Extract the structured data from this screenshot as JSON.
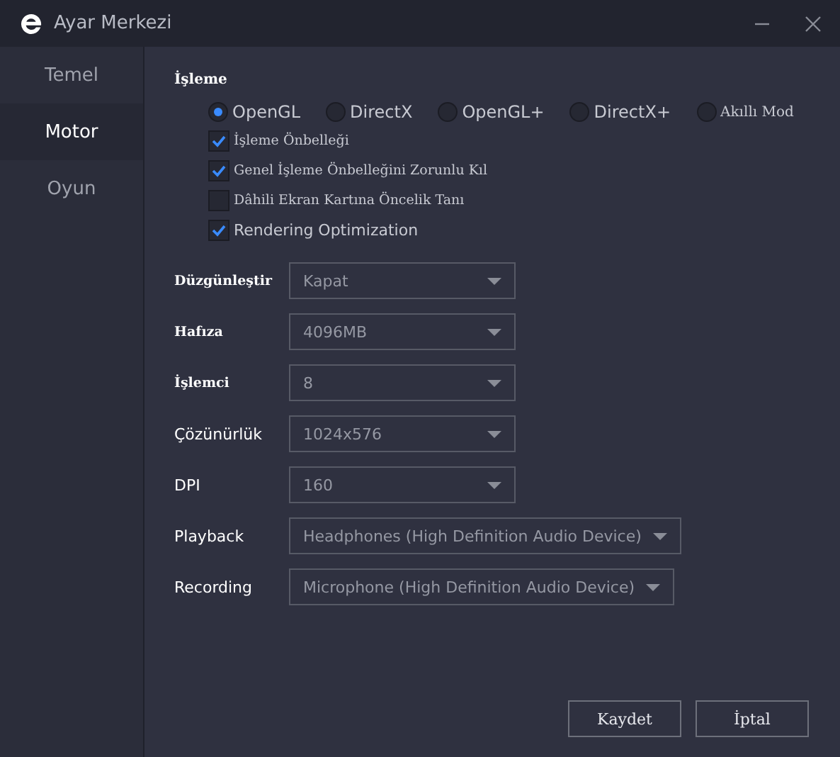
{
  "window": {
    "title": "Ayar Merkezi"
  },
  "sidebar": {
    "items": [
      {
        "label": "Temel",
        "selected": false
      },
      {
        "label": "Motor",
        "selected": true
      },
      {
        "label": "Oyun",
        "selected": false
      }
    ]
  },
  "rendering": {
    "title": "İşleme",
    "modes": [
      {
        "label": "OpenGL",
        "selected": true
      },
      {
        "label": "DirectX",
        "selected": false
      },
      {
        "label": "OpenGL+",
        "selected": false
      },
      {
        "label": "DirectX+",
        "selected": false
      },
      {
        "label": "Akıllı Mod",
        "selected": false
      }
    ],
    "options": [
      {
        "label": "İşleme Önbelleği",
        "checked": true
      },
      {
        "label": "Genel İşleme Önbelleğini Zorunlu Kıl",
        "checked": true
      },
      {
        "label": "Dâhili Ekran Kartına Öncelik Tanı",
        "checked": false
      },
      {
        "label": "Rendering Optimization",
        "checked": true
      }
    ]
  },
  "settings": [
    {
      "label": "Düzgünleştir",
      "value": "Kapat"
    },
    {
      "label": "Hafıza",
      "value": "4096MB"
    },
    {
      "label": "İşlemci",
      "value": "8"
    },
    {
      "label": "Çözünürlük",
      "value": "1024x576"
    },
    {
      "label": "DPI",
      "value": "160"
    },
    {
      "label": "Playback",
      "value": "Headphones (High Definition Audio Device)"
    },
    {
      "label": "Recording",
      "value": "Microphone (High Definition Audio Device)"
    }
  ],
  "buttons": [
    "Kaydet",
    "İptal"
  ]
}
